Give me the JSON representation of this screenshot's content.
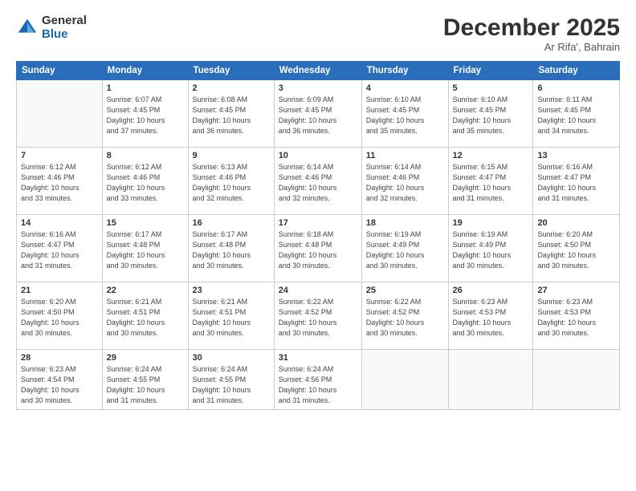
{
  "logo": {
    "general": "General",
    "blue": "Blue"
  },
  "header": {
    "month": "December 2025",
    "location": "Ar Rifa', Bahrain"
  },
  "weekdays": [
    "Sunday",
    "Monday",
    "Tuesday",
    "Wednesday",
    "Thursday",
    "Friday",
    "Saturday"
  ],
  "weeks": [
    [
      {
        "day": "",
        "info": ""
      },
      {
        "day": "1",
        "info": "Sunrise: 6:07 AM\nSunset: 4:45 PM\nDaylight: 10 hours\nand 37 minutes."
      },
      {
        "day": "2",
        "info": "Sunrise: 6:08 AM\nSunset: 4:45 PM\nDaylight: 10 hours\nand 36 minutes."
      },
      {
        "day": "3",
        "info": "Sunrise: 6:09 AM\nSunset: 4:45 PM\nDaylight: 10 hours\nand 36 minutes."
      },
      {
        "day": "4",
        "info": "Sunrise: 6:10 AM\nSunset: 4:45 PM\nDaylight: 10 hours\nand 35 minutes."
      },
      {
        "day": "5",
        "info": "Sunrise: 6:10 AM\nSunset: 4:45 PM\nDaylight: 10 hours\nand 35 minutes."
      },
      {
        "day": "6",
        "info": "Sunrise: 6:11 AM\nSunset: 4:45 PM\nDaylight: 10 hours\nand 34 minutes."
      }
    ],
    [
      {
        "day": "7",
        "info": "Sunrise: 6:12 AM\nSunset: 4:46 PM\nDaylight: 10 hours\nand 33 minutes."
      },
      {
        "day": "8",
        "info": "Sunrise: 6:12 AM\nSunset: 4:46 PM\nDaylight: 10 hours\nand 33 minutes."
      },
      {
        "day": "9",
        "info": "Sunrise: 6:13 AM\nSunset: 4:46 PM\nDaylight: 10 hours\nand 32 minutes."
      },
      {
        "day": "10",
        "info": "Sunrise: 6:14 AM\nSunset: 4:46 PM\nDaylight: 10 hours\nand 32 minutes."
      },
      {
        "day": "11",
        "info": "Sunrise: 6:14 AM\nSunset: 4:46 PM\nDaylight: 10 hours\nand 32 minutes."
      },
      {
        "day": "12",
        "info": "Sunrise: 6:15 AM\nSunset: 4:47 PM\nDaylight: 10 hours\nand 31 minutes."
      },
      {
        "day": "13",
        "info": "Sunrise: 6:16 AM\nSunset: 4:47 PM\nDaylight: 10 hours\nand 31 minutes."
      }
    ],
    [
      {
        "day": "14",
        "info": "Sunrise: 6:16 AM\nSunset: 4:47 PM\nDaylight: 10 hours\nand 31 minutes."
      },
      {
        "day": "15",
        "info": "Sunrise: 6:17 AM\nSunset: 4:48 PM\nDaylight: 10 hours\nand 30 minutes."
      },
      {
        "day": "16",
        "info": "Sunrise: 6:17 AM\nSunset: 4:48 PM\nDaylight: 10 hours\nand 30 minutes."
      },
      {
        "day": "17",
        "info": "Sunrise: 6:18 AM\nSunset: 4:48 PM\nDaylight: 10 hours\nand 30 minutes."
      },
      {
        "day": "18",
        "info": "Sunrise: 6:19 AM\nSunset: 4:49 PM\nDaylight: 10 hours\nand 30 minutes."
      },
      {
        "day": "19",
        "info": "Sunrise: 6:19 AM\nSunset: 4:49 PM\nDaylight: 10 hours\nand 30 minutes."
      },
      {
        "day": "20",
        "info": "Sunrise: 6:20 AM\nSunset: 4:50 PM\nDaylight: 10 hours\nand 30 minutes."
      }
    ],
    [
      {
        "day": "21",
        "info": "Sunrise: 6:20 AM\nSunset: 4:50 PM\nDaylight: 10 hours\nand 30 minutes."
      },
      {
        "day": "22",
        "info": "Sunrise: 6:21 AM\nSunset: 4:51 PM\nDaylight: 10 hours\nand 30 minutes."
      },
      {
        "day": "23",
        "info": "Sunrise: 6:21 AM\nSunset: 4:51 PM\nDaylight: 10 hours\nand 30 minutes."
      },
      {
        "day": "24",
        "info": "Sunrise: 6:22 AM\nSunset: 4:52 PM\nDaylight: 10 hours\nand 30 minutes."
      },
      {
        "day": "25",
        "info": "Sunrise: 6:22 AM\nSunset: 4:52 PM\nDaylight: 10 hours\nand 30 minutes."
      },
      {
        "day": "26",
        "info": "Sunrise: 6:23 AM\nSunset: 4:53 PM\nDaylight: 10 hours\nand 30 minutes."
      },
      {
        "day": "27",
        "info": "Sunrise: 6:23 AM\nSunset: 4:53 PM\nDaylight: 10 hours\nand 30 minutes."
      }
    ],
    [
      {
        "day": "28",
        "info": "Sunrise: 6:23 AM\nSunset: 4:54 PM\nDaylight: 10 hours\nand 30 minutes."
      },
      {
        "day": "29",
        "info": "Sunrise: 6:24 AM\nSunset: 4:55 PM\nDaylight: 10 hours\nand 31 minutes."
      },
      {
        "day": "30",
        "info": "Sunrise: 6:24 AM\nSunset: 4:55 PM\nDaylight: 10 hours\nand 31 minutes."
      },
      {
        "day": "31",
        "info": "Sunrise: 6:24 AM\nSunset: 4:56 PM\nDaylight: 10 hours\nand 31 minutes."
      },
      {
        "day": "",
        "info": ""
      },
      {
        "day": "",
        "info": ""
      },
      {
        "day": "",
        "info": ""
      }
    ]
  ]
}
